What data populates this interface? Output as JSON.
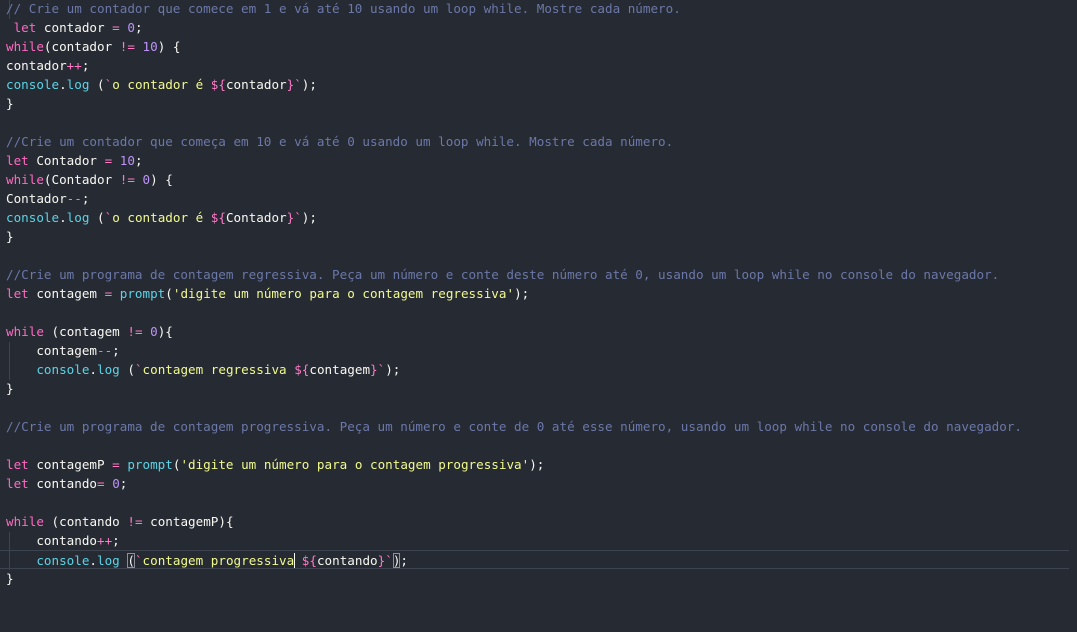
{
  "editor": {
    "lines": [
      [
        {
          "t": "comment",
          "v": "// Crie um contador que comece em 1 e vá até 10 usando um loop while. Mostre cada número."
        }
      ],
      [
        {
          "t": "ident",
          "v": " "
        },
        {
          "t": "keyword",
          "v": "let"
        },
        {
          "t": "ident",
          "v": " contador "
        },
        {
          "t": "operator",
          "v": "="
        },
        {
          "t": "ident",
          "v": " "
        },
        {
          "t": "number",
          "v": "0"
        },
        {
          "t": "punct",
          "v": ";"
        }
      ],
      [
        {
          "t": "keyword",
          "v": "while"
        },
        {
          "t": "punct",
          "v": "("
        },
        {
          "t": "ident",
          "v": "contador "
        },
        {
          "t": "operator",
          "v": "!="
        },
        {
          "t": "ident",
          "v": " "
        },
        {
          "t": "number",
          "v": "10"
        },
        {
          "t": "punct",
          "v": ") {"
        }
      ],
      [
        {
          "t": "ident",
          "v": "contador"
        },
        {
          "t": "operator",
          "v": "++"
        },
        {
          "t": "punct",
          "v": ";"
        }
      ],
      [
        {
          "t": "func",
          "v": "console"
        },
        {
          "t": "punct",
          "v": "."
        },
        {
          "t": "func",
          "v": "log"
        },
        {
          "t": "ident",
          "v": " "
        },
        {
          "t": "punct",
          "v": "("
        },
        {
          "t": "operator",
          "v": "`"
        },
        {
          "t": "string",
          "v": "o contador é "
        },
        {
          "t": "operator",
          "v": "${"
        },
        {
          "t": "ident",
          "v": "contador"
        },
        {
          "t": "operator",
          "v": "}`"
        },
        {
          "t": "punct",
          "v": ");"
        }
      ],
      [
        {
          "t": "punct",
          "v": "}"
        }
      ],
      [],
      [
        {
          "t": "comment",
          "v": "//Crie um contador que começa em 10 e vá até 0 usando um loop while. Mostre cada número."
        }
      ],
      [
        {
          "t": "keyword",
          "v": "let"
        },
        {
          "t": "ident",
          "v": " Contador "
        },
        {
          "t": "operator",
          "v": "="
        },
        {
          "t": "ident",
          "v": " "
        },
        {
          "t": "number",
          "v": "10"
        },
        {
          "t": "punct",
          "v": ";"
        }
      ],
      [
        {
          "t": "keyword",
          "v": "while"
        },
        {
          "t": "punct",
          "v": "("
        },
        {
          "t": "ident",
          "v": "Contador "
        },
        {
          "t": "operator",
          "v": "!="
        },
        {
          "t": "ident",
          "v": " "
        },
        {
          "t": "number",
          "v": "0"
        },
        {
          "t": "punct",
          "v": ") {"
        }
      ],
      [
        {
          "t": "ident",
          "v": "Contador"
        },
        {
          "t": "operator",
          "v": "--"
        },
        {
          "t": "punct",
          "v": ";"
        }
      ],
      [
        {
          "t": "func",
          "v": "console"
        },
        {
          "t": "punct",
          "v": "."
        },
        {
          "t": "func",
          "v": "log"
        },
        {
          "t": "ident",
          "v": " "
        },
        {
          "t": "punct",
          "v": "("
        },
        {
          "t": "operator",
          "v": "`"
        },
        {
          "t": "string",
          "v": "o contador é "
        },
        {
          "t": "operator",
          "v": "${"
        },
        {
          "t": "ident",
          "v": "Contador"
        },
        {
          "t": "operator",
          "v": "}`"
        },
        {
          "t": "punct",
          "v": ");"
        }
      ],
      [
        {
          "t": "punct",
          "v": "}"
        }
      ],
      [],
      [
        {
          "t": "comment",
          "v": "//Crie um programa de contagem regressiva. Peça um número e conte deste número até 0, usando um loop while no console do navegador."
        }
      ],
      [
        {
          "t": "keyword",
          "v": "let"
        },
        {
          "t": "ident",
          "v": " contagem "
        },
        {
          "t": "operator",
          "v": "="
        },
        {
          "t": "ident",
          "v": " "
        },
        {
          "t": "func",
          "v": "prompt"
        },
        {
          "t": "punct",
          "v": "("
        },
        {
          "t": "string",
          "v": "'digite um número para o contagem regressiva'"
        },
        {
          "t": "punct",
          "v": ");"
        }
      ],
      [],
      [
        {
          "t": "keyword",
          "v": "while"
        },
        {
          "t": "ident",
          "v": " "
        },
        {
          "t": "punct",
          "v": "("
        },
        {
          "t": "ident",
          "v": "contagem "
        },
        {
          "t": "operator",
          "v": "!="
        },
        {
          "t": "ident",
          "v": " "
        },
        {
          "t": "number",
          "v": "0"
        },
        {
          "t": "punct",
          "v": "){"
        }
      ],
      [
        {
          "t": "ident",
          "v": "    contagem"
        },
        {
          "t": "operator",
          "v": "--"
        },
        {
          "t": "punct",
          "v": ";"
        }
      ],
      [
        {
          "t": "ident",
          "v": "    "
        },
        {
          "t": "func",
          "v": "console"
        },
        {
          "t": "punct",
          "v": "."
        },
        {
          "t": "func",
          "v": "log"
        },
        {
          "t": "ident",
          "v": " "
        },
        {
          "t": "punct",
          "v": "("
        },
        {
          "t": "operator",
          "v": "`"
        },
        {
          "t": "string",
          "v": "contagem regressiva "
        },
        {
          "t": "operator",
          "v": "${"
        },
        {
          "t": "ident",
          "v": "contagem"
        },
        {
          "t": "operator",
          "v": "}`"
        },
        {
          "t": "punct",
          "v": ");"
        }
      ],
      [
        {
          "t": "punct",
          "v": "}"
        }
      ],
      [],
      [
        {
          "t": "comment",
          "v": "//Crie um programa de contagem progressiva. Peça um número e conte de 0 até esse número, usando um loop while no console do navegador."
        }
      ],
      [],
      [
        {
          "t": "keyword",
          "v": "let"
        },
        {
          "t": "ident",
          "v": " contagemP "
        },
        {
          "t": "operator",
          "v": "="
        },
        {
          "t": "ident",
          "v": " "
        },
        {
          "t": "func",
          "v": "prompt"
        },
        {
          "t": "punct",
          "v": "("
        },
        {
          "t": "string",
          "v": "'digite um número para o contagem progressiva'"
        },
        {
          "t": "punct",
          "v": ");"
        }
      ],
      [
        {
          "t": "keyword",
          "v": "let"
        },
        {
          "t": "ident",
          "v": " contando"
        },
        {
          "t": "operator",
          "v": "="
        },
        {
          "t": "ident",
          "v": " "
        },
        {
          "t": "number",
          "v": "0"
        },
        {
          "t": "punct",
          "v": ";"
        }
      ],
      [],
      [
        {
          "t": "keyword",
          "v": "while"
        },
        {
          "t": "ident",
          "v": " "
        },
        {
          "t": "punct",
          "v": "("
        },
        {
          "t": "ident",
          "v": "contando "
        },
        {
          "t": "operator",
          "v": "!="
        },
        {
          "t": "ident",
          "v": " contagemP"
        },
        {
          "t": "punct",
          "v": "){"
        }
      ],
      [
        {
          "t": "ident",
          "v": "    contando"
        },
        {
          "t": "operator",
          "v": "++"
        },
        {
          "t": "punct",
          "v": ";"
        }
      ],
      [
        {
          "t": "ident",
          "v": "    "
        },
        {
          "t": "func",
          "v": "console"
        },
        {
          "t": "punct",
          "v": "."
        },
        {
          "t": "func",
          "v": "log"
        },
        {
          "t": "ident",
          "v": " "
        },
        {
          "t": "punct",
          "v": "(",
          "m": "bracket"
        },
        {
          "t": "operator",
          "v": "`"
        },
        {
          "t": "string",
          "v": "contagem progressiva"
        },
        {
          "t": "cursor",
          "v": ""
        },
        {
          "t": "string",
          "v": " "
        },
        {
          "t": "operator",
          "v": "${"
        },
        {
          "t": "ident",
          "v": "contando"
        },
        {
          "t": "operator",
          "v": "}`"
        },
        {
          "t": "punct",
          "v": ")",
          "m": "bracket"
        },
        {
          "t": "punct",
          "v": ";"
        }
      ],
      [
        {
          "t": "punct",
          "v": "}"
        }
      ]
    ],
    "current_line": 29,
    "colors": {
      "background": "#262a33",
      "comment": "#6b78a8",
      "keyword": "#ff6ac1",
      "number": "#bd93f9",
      "string": "#f1fa8c",
      "function": "#5ad4e6",
      "text": "#f8f8f2"
    }
  }
}
